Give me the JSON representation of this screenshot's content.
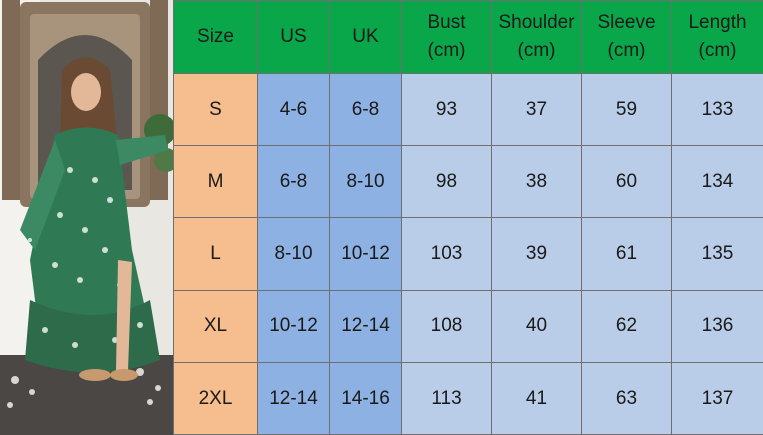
{
  "size_chart": {
    "headers": {
      "size": "Size",
      "us": "US",
      "uk": "UK",
      "bust": [
        "Bust",
        "(cm)"
      ],
      "shoulder": [
        "Shoulder",
        "(cm)"
      ],
      "sleeve": [
        "Sleeve",
        "(cm)"
      ],
      "length": [
        "Length",
        "(cm)"
      ]
    },
    "rows": [
      {
        "size": "S",
        "us": "4-6",
        "uk": "6-8",
        "bust": "93",
        "shoulder": "37",
        "sleeve": "59",
        "length": "133"
      },
      {
        "size": "M",
        "us": "6-8",
        "uk": "8-10",
        "bust": "98",
        "shoulder": "38",
        "sleeve": "60",
        "length": "134"
      },
      {
        "size": "L",
        "us": "8-10",
        "uk": "10-12",
        "bust": "103",
        "shoulder": "39",
        "sleeve": "61",
        "length": "135"
      },
      {
        "size": "XL",
        "us": "10-12",
        "uk": "12-14",
        "bust": "108",
        "shoulder": "40",
        "sleeve": "62",
        "length": "136"
      },
      {
        "size": "2XL",
        "us": "12-14",
        "uk": "14-16",
        "bust": "113",
        "shoulder": "41",
        "sleeve": "63",
        "length": "137"
      }
    ]
  },
  "colors": {
    "header_bg": "#0aa64a",
    "size_col_bg": "#f6bd8e",
    "us_uk_col_bg": "#8db1e2",
    "measure_col_bg": "#b9cde8",
    "border": "#6f6f6f"
  },
  "image": {
    "subject": "model-wearing-green-floral-maxi-dress"
  }
}
